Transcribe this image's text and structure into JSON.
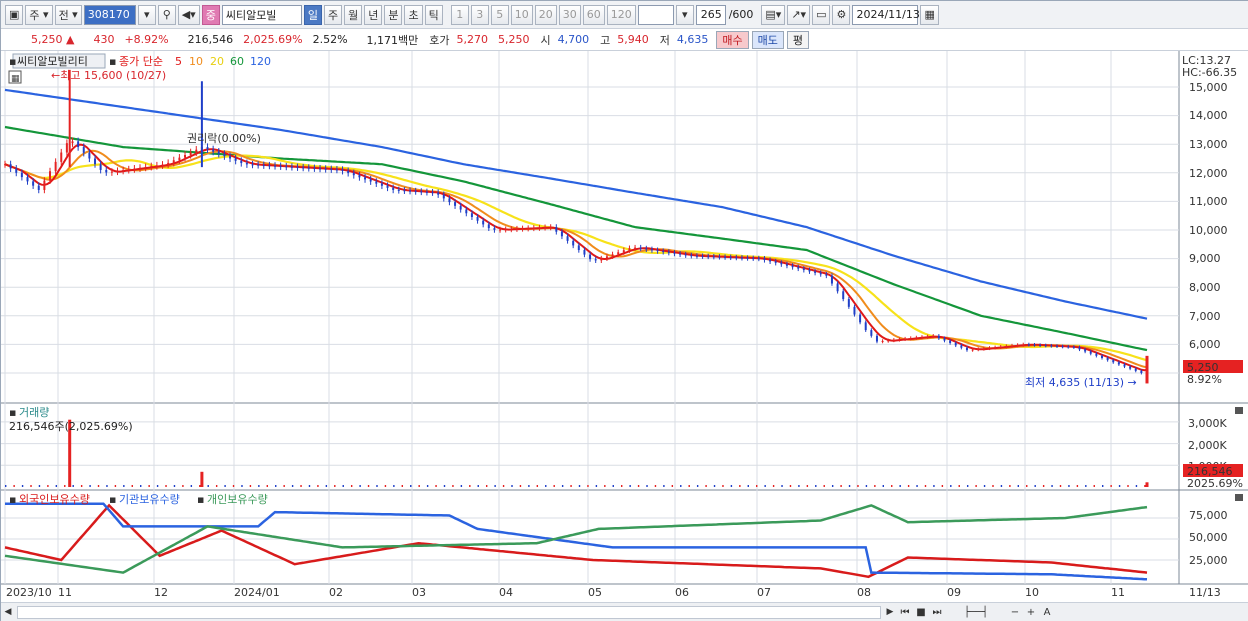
{
  "toolbar": {
    "period_label": "주",
    "prev_label": "전",
    "code": "308170",
    "name_tag": "중",
    "name": "씨티알모빌",
    "tf_buttons": [
      "일",
      "주",
      "월",
      "년",
      "분",
      "초",
      "틱"
    ],
    "tf_active": 0,
    "n_buttons": [
      "1",
      "3",
      "5",
      "10",
      "20",
      "30",
      "60",
      "120"
    ],
    "count": "265",
    "count_total": "/600",
    "date": "2024/11/13"
  },
  "quote": {
    "price": "5,250",
    "arrow": "▲",
    "change": "430",
    "change_pct": "+8.92%",
    "volume": "216,546",
    "volume_pct": "2,025.69%",
    "turnover_pct": "2.52%",
    "amount": "1,171백만",
    "bid_label": "호가",
    "bid1": "5,270",
    "bid2": "5,250",
    "open_label": "시",
    "open": "4,700",
    "high_label": "고",
    "high": "5,940",
    "low_label": "저",
    "low": "4,635",
    "buy_label": "매수",
    "sell_label": "매도",
    "eval_label": "평"
  },
  "colors": {
    "up": "#e52222",
    "down": "#1f3fc8",
    "ma5": "#e01818",
    "ma10": "#f08c1c",
    "ma20": "#f7e21a",
    "ma60": "#14963a",
    "ma120": "#2b63e0",
    "foreign": "#d81b1b",
    "institution": "#2b63e0",
    "individual": "#3b9a5a",
    "grid": "#d9dde4"
  },
  "price_panel": {
    "stock_label": "씨티알모빌리티",
    "ma_label": "종가 단순",
    "ma_periods": [
      "5",
      "10",
      "20",
      "60",
      "120"
    ],
    "lc_label": "LC:13.27",
    "hc_label": "HC:-66.35",
    "high_note": "←최고 15,600 (10/27)",
    "low_note": "최저 4,635 (11/13) →",
    "event_note": "권리락(0.00%)",
    "last_price_tag": "5,250",
    "last_change_tag": "8.92%",
    "y_ticks": [
      "15,000",
      "14,000",
      "13,000",
      "12,000",
      "11,000",
      "10,000",
      "9,000",
      "8,000",
      "7,000",
      "6,000",
      "5,000"
    ]
  },
  "volume_panel": {
    "title": "거래량",
    "subtitle": "216,546주(2,025.69%)",
    "y_ticks": [
      "3,000K",
      "2,000K",
      "1,000K"
    ],
    "last_tag": "216,546",
    "last_pct_tag": "2025.69%"
  },
  "holding_panel": {
    "legend": [
      "외국인보유수량",
      "기관보유수량",
      "개인보유수량"
    ],
    "y_ticks": [
      "75,000",
      "50,000",
      "25,000"
    ]
  },
  "x_axis": {
    "labels": [
      "2023/10",
      "11",
      "12",
      "2024/01",
      "02",
      "03",
      "04",
      "05",
      "06",
      "07",
      "08",
      "09",
      "10",
      "11"
    ],
    "last_date": "11/13"
  },
  "chart_data": {
    "type": "line",
    "title": "씨티알모빌리티",
    "x_range": [
      "2023-10-04",
      "2024-11-13"
    ],
    "ylim": [
      4500,
      15800
    ],
    "close_waypoints": [
      {
        "x": "2023-10-04",
        "y": 12300
      },
      {
        "x": "2023-10-16",
        "y": 11400
      },
      {
        "x": "2023-10-27",
        "y": 13200
      },
      {
        "x": "2023-11-08",
        "y": 12000
      },
      {
        "x": "2023-11-30",
        "y": 12300
      },
      {
        "x": "2023-12-13",
        "y": 12900
      },
      {
        "x": "2023-12-28",
        "y": 12300
      },
      {
        "x": "2024-01-31",
        "y": 12100
      },
      {
        "x": "2024-02-19",
        "y": 11400
      },
      {
        "x": "2024-03-05",
        "y": 11300
      },
      {
        "x": "2024-03-25",
        "y": 10000
      },
      {
        "x": "2024-04-15",
        "y": 10100
      },
      {
        "x": "2024-04-30",
        "y": 8900
      },
      {
        "x": "2024-05-14",
        "y": 9400
      },
      {
        "x": "2024-06-03",
        "y": 9100
      },
      {
        "x": "2024-06-28",
        "y": 9000
      },
      {
        "x": "2024-07-22",
        "y": 8400
      },
      {
        "x": "2024-08-05",
        "y": 6500
      },
      {
        "x": "2024-08-09",
        "y": 6100
      },
      {
        "x": "2024-08-29",
        "y": 6300
      },
      {
        "x": "2024-09-10",
        "y": 5800
      },
      {
        "x": "2024-09-30",
        "y": 6000
      },
      {
        "x": "2024-10-18",
        "y": 5900
      },
      {
        "x": "2024-11-11",
        "y": 5000
      },
      {
        "x": "2024-11-13",
        "y": 5250
      }
    ],
    "ma60_waypoints": [
      {
        "x": "2023-10-04",
        "y": 13600
      },
      {
        "x": "2023-11-15",
        "y": 12900
      },
      {
        "x": "2024-01-10",
        "y": 12500
      },
      {
        "x": "2024-02-15",
        "y": 12300
      },
      {
        "x": "2024-03-15",
        "y": 11700
      },
      {
        "x": "2024-04-15",
        "y": 10900
      },
      {
        "x": "2024-05-15",
        "y": 10100
      },
      {
        "x": "2024-06-15",
        "y": 9700
      },
      {
        "x": "2024-07-15",
        "y": 9300
      },
      {
        "x": "2024-08-15",
        "y": 8100
      },
      {
        "x": "2024-09-15",
        "y": 7000
      },
      {
        "x": "2024-10-15",
        "y": 6400
      },
      {
        "x": "2024-11-13",
        "y": 5800
      }
    ],
    "ma120_waypoints": [
      {
        "x": "2023-10-04",
        "y": 14900
      },
      {
        "x": "2023-11-15",
        "y": 14300
      },
      {
        "x": "2024-01-10",
        "y": 13500
      },
      {
        "x": "2024-02-15",
        "y": 12900
      },
      {
        "x": "2024-03-15",
        "y": 12300
      },
      {
        "x": "2024-04-15",
        "y": 11800
      },
      {
        "x": "2024-05-15",
        "y": 11300
      },
      {
        "x": "2024-06-15",
        "y": 10800
      },
      {
        "x": "2024-07-15",
        "y": 10100
      },
      {
        "x": "2024-08-15",
        "y": 9100
      },
      {
        "x": "2024-09-15",
        "y": 8200
      },
      {
        "x": "2024-10-15",
        "y": 7500
      },
      {
        "x": "2024-11-13",
        "y": 6900
      }
    ],
    "highs": [
      {
        "x": "2023-10-27",
        "y": 15600,
        "label": "최고 15,600"
      },
      {
        "x": "2023-12-13",
        "y": 15200
      }
    ],
    "low": {
      "x": "2024-11-13",
      "y": 4635,
      "label": "최저 4,635"
    },
    "volume": {
      "ylim": [
        0,
        3500
      ],
      "unit": "K",
      "bars": [
        {
          "x": "2023-10-27",
          "y": 3100
        },
        {
          "x": "2023-12-13",
          "y": 700
        },
        {
          "x": "2024-11-13",
          "y": 216.5
        }
      ]
    },
    "holdings": {
      "ylim": [
        0,
        100000
      ],
      "series": [
        {
          "name": "외국인보유수량",
          "waypoints": [
            {
              "x": "2023-10-04",
              "y": 40000
            },
            {
              "x": "2023-10-24",
              "y": 25000
            },
            {
              "x": "2023-11-10",
              "y": 90000
            },
            {
              "x": "2023-11-28",
              "y": 30000
            },
            {
              "x": "2023-12-20",
              "y": 60000
            },
            {
              "x": "2024-01-15",
              "y": 20000
            },
            {
              "x": "2024-02-28",
              "y": 45000
            },
            {
              "x": "2024-04-30",
              "y": 25000
            },
            {
              "x": "2024-07-20",
              "y": 15000
            },
            {
              "x": "2024-08-06",
              "y": 5000
            },
            {
              "x": "2024-08-20",
              "y": 28000
            },
            {
              "x": "2024-10-10",
              "y": 22000
            },
            {
              "x": "2024-11-13",
              "y": 10000
            }
          ]
        },
        {
          "name": "기관보유수량",
          "waypoints": [
            {
              "x": "2023-10-04",
              "y": 92000
            },
            {
              "x": "2023-11-08",
              "y": 92000
            },
            {
              "x": "2023-11-15",
              "y": 65000
            },
            {
              "x": "2024-01-02",
              "y": 65000
            },
            {
              "x": "2024-01-08",
              "y": 82000
            },
            {
              "x": "2024-03-10",
              "y": 78000
            },
            {
              "x": "2024-03-20",
              "y": 62000
            },
            {
              "x": "2024-05-07",
              "y": 40000
            },
            {
              "x": "2024-08-05",
              "y": 40000
            },
            {
              "x": "2024-08-07",
              "y": 10000
            },
            {
              "x": "2024-10-10",
              "y": 8000
            },
            {
              "x": "2024-11-13",
              "y": 2000
            }
          ]
        },
        {
          "name": "개인보유수량",
          "waypoints": [
            {
              "x": "2023-10-04",
              "y": 30000
            },
            {
              "x": "2023-11-15",
              "y": 10000
            },
            {
              "x": "2023-12-15",
              "y": 65000
            },
            {
              "x": "2024-02-01",
              "y": 40000
            },
            {
              "x": "2024-04-10",
              "y": 45000
            },
            {
              "x": "2024-05-02",
              "y": 62000
            },
            {
              "x": "2024-07-20",
              "y": 72000
            },
            {
              "x": "2024-08-07",
              "y": 90000
            },
            {
              "x": "2024-08-20",
              "y": 70000
            },
            {
              "x": "2024-10-15",
              "y": 75000
            },
            {
              "x": "2024-11-13",
              "y": 88000
            }
          ]
        }
      ]
    }
  }
}
